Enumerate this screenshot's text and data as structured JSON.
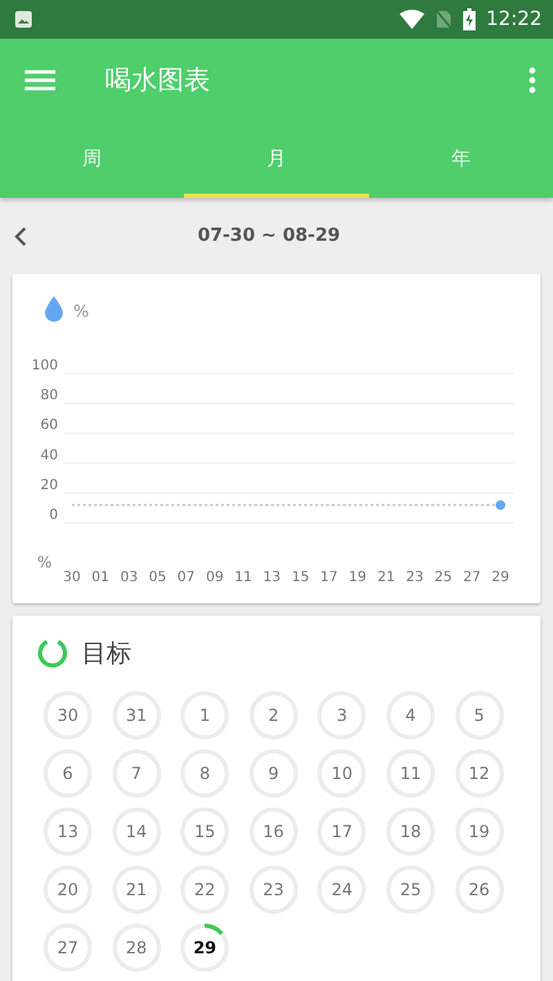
{
  "status_bar": {
    "time": "12:22"
  },
  "toolbar": {
    "title": "喝水图表"
  },
  "tabs": [
    {
      "label": "周",
      "selected": false
    },
    {
      "label": "月",
      "selected": true
    },
    {
      "label": "年",
      "selected": false
    }
  ],
  "range": {
    "label": "07-30 ~ 08-29"
  },
  "chart_card": {
    "chart_data": {
      "type": "line",
      "ylabel": "%",
      "grid": true,
      "categories": [
        "30",
        "01",
        "03",
        "05",
        "07",
        "09",
        "11",
        "13",
        "15",
        "17",
        "19",
        "21",
        "23",
        "25",
        "27",
        "29"
      ],
      "series": [
        {
          "name": "%",
          "color": "#c8c8c8",
          "line_style": "dashed",
          "values": [
            12,
            12,
            12,
            12,
            12,
            12,
            12,
            12,
            12,
            12,
            12,
            12,
            12,
            12,
            12,
            12
          ]
        }
      ],
      "ylim": [
        0,
        100
      ],
      "yticks": [
        0,
        20,
        40,
        60,
        80,
        100
      ]
    }
  },
  "goal_card": {
    "title": "目标",
    "days": [
      {
        "label": "30",
        "started": false,
        "today": false
      },
      {
        "label": "31",
        "started": false,
        "today": false
      },
      {
        "label": "1",
        "started": false,
        "today": false
      },
      {
        "label": "2",
        "started": false,
        "today": false
      },
      {
        "label": "3",
        "started": false,
        "today": false
      },
      {
        "label": "4",
        "started": false,
        "today": false
      },
      {
        "label": "5",
        "started": false,
        "today": false
      },
      {
        "label": "6",
        "started": false,
        "today": false
      },
      {
        "label": "7",
        "started": false,
        "today": false
      },
      {
        "label": "8",
        "started": false,
        "today": false
      },
      {
        "label": "9",
        "started": false,
        "today": false
      },
      {
        "label": "10",
        "started": false,
        "today": false
      },
      {
        "label": "11",
        "started": false,
        "today": false
      },
      {
        "label": "12",
        "started": false,
        "today": false
      },
      {
        "label": "13",
        "started": false,
        "today": false
      },
      {
        "label": "14",
        "started": false,
        "today": false
      },
      {
        "label": "15",
        "started": false,
        "today": false
      },
      {
        "label": "16",
        "started": false,
        "today": false
      },
      {
        "label": "17",
        "started": false,
        "today": false
      },
      {
        "label": "18",
        "started": false,
        "today": false
      },
      {
        "label": "19",
        "started": false,
        "today": false
      },
      {
        "label": "20",
        "started": false,
        "today": false
      },
      {
        "label": "21",
        "started": false,
        "today": false
      },
      {
        "label": "22",
        "started": false,
        "today": false
      },
      {
        "label": "23",
        "started": false,
        "today": false
      },
      {
        "label": "24",
        "started": false,
        "today": false
      },
      {
        "label": "25",
        "started": false,
        "today": false
      },
      {
        "label": "26",
        "started": false,
        "today": false
      },
      {
        "label": "27",
        "started": false,
        "today": false
      },
      {
        "label": "28",
        "started": false,
        "today": false
      },
      {
        "label": "29",
        "started": true,
        "today": true
      }
    ]
  }
}
